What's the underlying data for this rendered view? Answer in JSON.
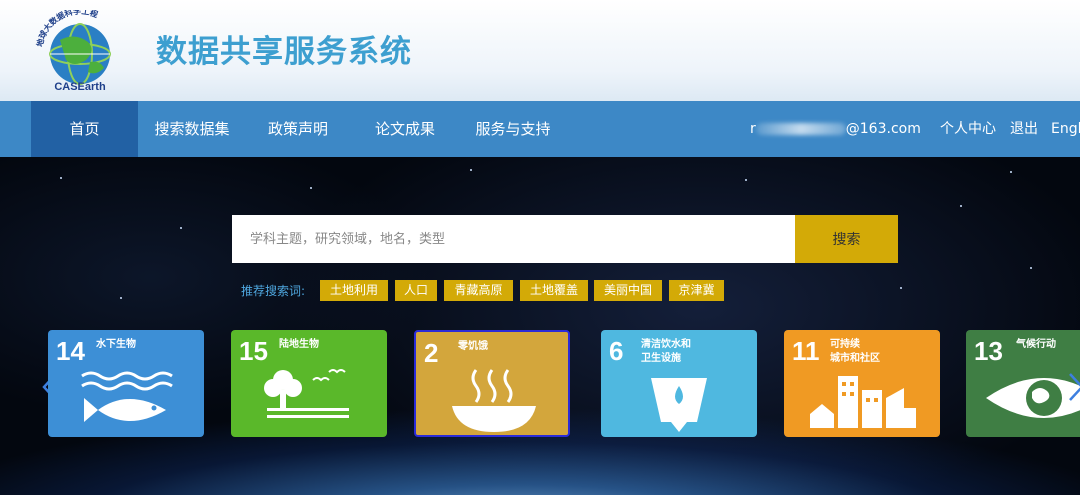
{
  "header": {
    "logo_text_top": "地球大数据科学工程",
    "logo_text_bottom": "CASEarth",
    "site_title": "数据共享服务系统"
  },
  "nav": {
    "items": [
      {
        "label": "首页",
        "active": true
      },
      {
        "label": "搜索数据集",
        "active": false
      },
      {
        "label": "政策声明",
        "active": false
      },
      {
        "label": "论文成果",
        "active": false
      },
      {
        "label": "服务与支持",
        "active": false
      }
    ],
    "user_email_prefix": "r",
    "user_email_suffix": "@163.com",
    "personal_center": "个人中心",
    "logout": "退出",
    "language": "Engl"
  },
  "search": {
    "placeholder": "学科主题，研究领域，地名，类型",
    "button": "搜索",
    "recommend_label": "推荐搜索词:",
    "tags": [
      "土地利用",
      "人口",
      "青藏高原",
      "土地覆盖",
      "美丽中国",
      "京津冀"
    ]
  },
  "sdg_cards": [
    {
      "number": "14",
      "label": "水下生物",
      "color": "#3d8fd6",
      "icon": "fish-icon"
    },
    {
      "number": "15",
      "label": "陆地生物",
      "color": "#5ab82a",
      "icon": "tree-icon"
    },
    {
      "number": "2",
      "label": "零饥饿",
      "color": "#d3a63c",
      "icon": "bowl-icon",
      "selected": true
    },
    {
      "number": "6",
      "label": "清洁饮水和\n卫生设施",
      "color": "#4fb8e0",
      "icon": "water-glass-icon"
    },
    {
      "number": "11",
      "label": "可持续\n城市和社区",
      "color": "#f09a23",
      "icon": "city-icon"
    },
    {
      "number": "13",
      "label": "气候行动",
      "color": "#3f7e44",
      "icon": "eye-globe-icon"
    }
  ],
  "colors": {
    "nav_bg": "#3d88c6",
    "nav_active": "#2261a4",
    "accent_gold": "#d3aa07",
    "title_blue": "#3d9fd0"
  }
}
